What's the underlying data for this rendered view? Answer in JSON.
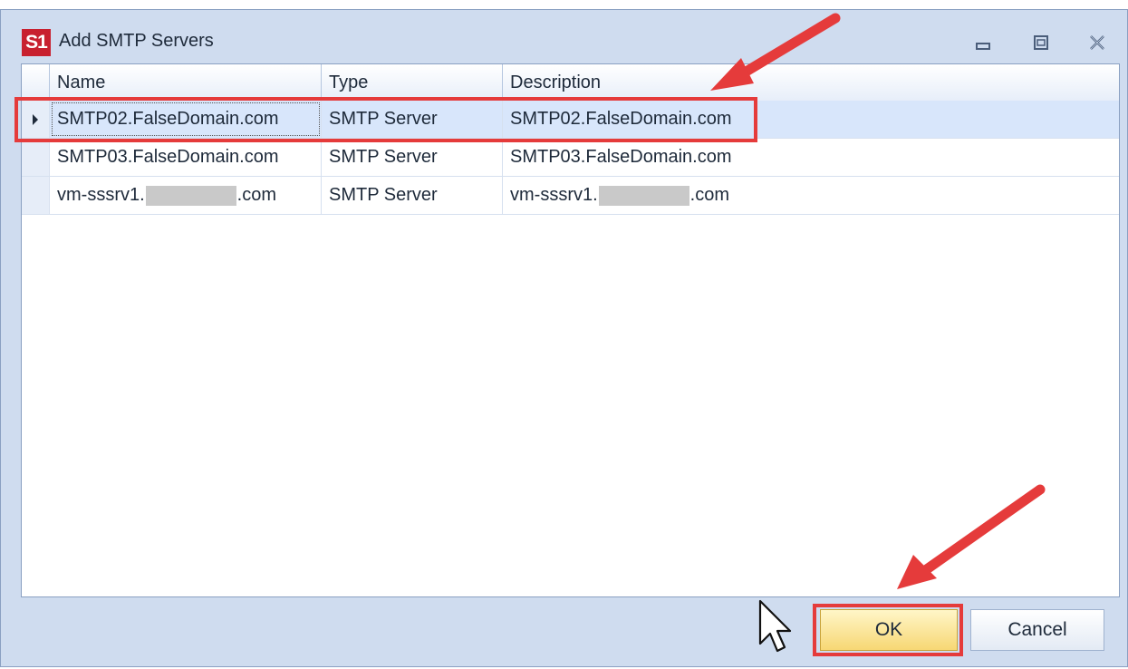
{
  "window": {
    "app_icon_text": "S1",
    "title": "Add SMTP Servers"
  },
  "grid": {
    "columns": [
      "Name",
      "Type",
      "Description"
    ],
    "rows": [
      {
        "name": "SMTP02.FalseDomain.com",
        "type": "SMTP Server",
        "description": "SMTP02.FalseDomain.com",
        "selected": true
      },
      {
        "name": "SMTP03.FalseDomain.com",
        "type": "SMTP Server",
        "description": "SMTP03.FalseDomain.com",
        "selected": false
      },
      {
        "name_prefix": "vm-sssrv1.",
        "name_suffix": ".com",
        "type": "SMTP Server",
        "desc_prefix": "vm-sssrv1.",
        "desc_suffix": ".com",
        "redacted": true,
        "selected": false
      }
    ]
  },
  "buttons": {
    "ok": "OK",
    "cancel": "Cancel"
  },
  "annotations": {
    "highlight_color": "#e53b3b",
    "arrow_color": "#e53b3b"
  },
  "colors": {
    "window_bg": "#cfdcef",
    "selected_row": "#d8e6fb",
    "ok_button": "#f7d774"
  }
}
